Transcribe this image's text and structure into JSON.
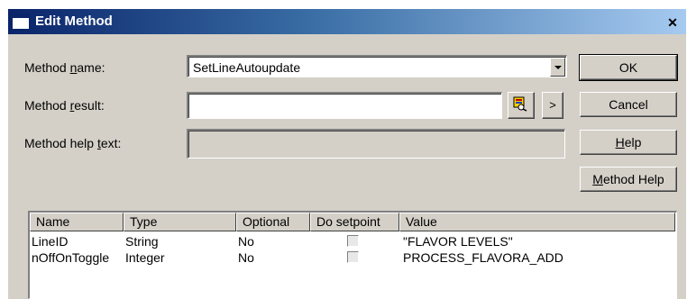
{
  "window": {
    "title": "Edit Method",
    "close_glyph": "✕"
  },
  "form": {
    "method_name": {
      "label_before": "Method ",
      "label_accel": "n",
      "label_after": "ame:",
      "value": "SetLineAutoupdate"
    },
    "method_result": {
      "label_before": "Method ",
      "label_accel": "r",
      "label_after": "esult:",
      "value": ""
    },
    "method_help_text": {
      "label_before": "Method help ",
      "label_accel": "t",
      "label_after": "ext:",
      "value": ""
    }
  },
  "buttons": {
    "ok": "OK",
    "cancel": "Cancel",
    "help_accel": "H",
    "help_rest": "elp",
    "method_help_accel": "M",
    "method_help_rest": "ethod Help",
    "expand_glyph": ">"
  },
  "icons": {
    "lookup": "lookup-tag-icon",
    "combo": "chevron-down-icon",
    "close": "close-icon"
  },
  "parameters": {
    "columns": [
      "Name",
      "Type",
      "Optional",
      "Do setpoint",
      "Value"
    ],
    "rows": [
      {
        "name": "LineID",
        "type": "String",
        "optional": "No",
        "do_setpoint": false,
        "value": "\"FLAVOR LEVELS\""
      },
      {
        "name": "nOffOnToggle",
        "type": "Integer",
        "optional": "No",
        "do_setpoint": false,
        "value": "PROCESS_FLAVORA_ADD"
      }
    ]
  },
  "colors": {
    "face": "#d4d0c8",
    "title_start": "#0a246a",
    "title_end": "#a6caf0"
  }
}
